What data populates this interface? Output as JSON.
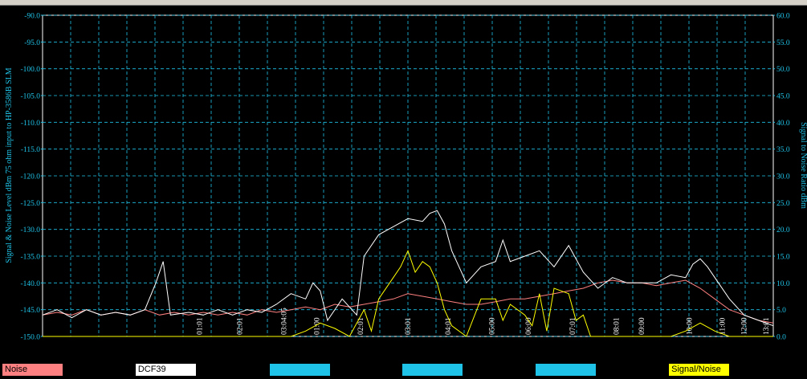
{
  "chart_data": {
    "type": "line",
    "left_axis": {
      "label": "Signal & Noise Level  dBm 75 ohm input to HP-3586B SLM",
      "min": -150,
      "max": -90,
      "step": 5,
      "ticks": [
        "-90.0",
        "-95.0",
        "-100.0",
        "-105.0",
        "-110.0",
        "-115.0",
        "-120.0",
        "-125.0",
        "-130.0",
        "-135.0",
        "-140.0",
        "-145.0",
        "-150.0"
      ]
    },
    "right_axis": {
      "label": "Signal to Noise Ratio  dBm",
      "min": 0,
      "max": 60,
      "step": 5,
      "ticks": [
        "60.0",
        "55.0",
        "50.0",
        "45.0",
        "40.0",
        "35.0",
        "30.0",
        "25.0",
        "20.0",
        "15.0",
        "10.0",
        "5.0",
        "0.0"
      ]
    },
    "x_tick_labels": [
      {
        "x": 0.215,
        "text": "01:01"
      },
      {
        "x": 0.27,
        "text": "02:01"
      },
      {
        "x": 0.33,
        "text": "03:04:05"
      },
      {
        "x": 0.375,
        "text": "01:00"
      },
      {
        "x": 0.435,
        "text": "02:01"
      },
      {
        "x": 0.5,
        "text": "03:01"
      },
      {
        "x": 0.555,
        "text": "04:01"
      },
      {
        "x": 0.615,
        "text": "05:00"
      },
      {
        "x": 0.665,
        "text": "06:00"
      },
      {
        "x": 0.725,
        "text": "07:01"
      },
      {
        "x": 0.785,
        "text": "08:01"
      },
      {
        "x": 0.82,
        "text": "09:00"
      },
      {
        "x": 0.885,
        "text": "10:00"
      },
      {
        "x": 0.93,
        "text": "11:00"
      },
      {
        "x": 0.96,
        "text": "12:00"
      },
      {
        "x": 0.99,
        "text": "13:01"
      }
    ],
    "grid": true,
    "series": [
      {
        "name": "Noise",
        "axis": "left",
        "color": "#ff8080",
        "points": [
          [
            0,
            -146
          ],
          [
            0.02,
            -145.5
          ],
          [
            0.04,
            -146
          ],
          [
            0.06,
            -145
          ],
          [
            0.08,
            -146
          ],
          [
            0.1,
            -145.5
          ],
          [
            0.12,
            -146
          ],
          [
            0.14,
            -145
          ],
          [
            0.16,
            -146
          ],
          [
            0.18,
            -145.5
          ],
          [
            0.2,
            -146
          ],
          [
            0.22,
            -145.5
          ],
          [
            0.24,
            -146
          ],
          [
            0.26,
            -145.5
          ],
          [
            0.28,
            -146
          ],
          [
            0.3,
            -145
          ],
          [
            0.32,
            -145.5
          ],
          [
            0.34,
            -145
          ],
          [
            0.36,
            -144.5
          ],
          [
            0.38,
            -145
          ],
          [
            0.4,
            -144
          ],
          [
            0.42,
            -144.5
          ],
          [
            0.44,
            -144
          ],
          [
            0.46,
            -143.5
          ],
          [
            0.48,
            -143
          ],
          [
            0.5,
            -142
          ],
          [
            0.52,
            -142.5
          ],
          [
            0.54,
            -143
          ],
          [
            0.56,
            -143.5
          ],
          [
            0.58,
            -144
          ],
          [
            0.6,
            -144
          ],
          [
            0.62,
            -143.5
          ],
          [
            0.64,
            -143
          ],
          [
            0.66,
            -143
          ],
          [
            0.68,
            -142.5
          ],
          [
            0.7,
            -142
          ],
          [
            0.72,
            -141.5
          ],
          [
            0.74,
            -141
          ],
          [
            0.76,
            -140
          ],
          [
            0.78,
            -139.5
          ],
          [
            0.8,
            -140
          ],
          [
            0.82,
            -140
          ],
          [
            0.84,
            -140.5
          ],
          [
            0.86,
            -140
          ],
          [
            0.88,
            -139.5
          ],
          [
            0.9,
            -141
          ],
          [
            0.92,
            -143
          ],
          [
            0.94,
            -145
          ],
          [
            0.96,
            -146
          ],
          [
            0.98,
            -147
          ],
          [
            1,
            -147.5
          ]
        ]
      },
      {
        "name": "DCF39",
        "axis": "left",
        "color": "#ffffff",
        "points": [
          [
            0,
            -146
          ],
          [
            0.02,
            -145
          ],
          [
            0.04,
            -146.5
          ],
          [
            0.06,
            -145
          ],
          [
            0.08,
            -146
          ],
          [
            0.1,
            -145.5
          ],
          [
            0.12,
            -146
          ],
          [
            0.14,
            -145
          ],
          [
            0.155,
            -140
          ],
          [
            0.165,
            -136
          ],
          [
            0.175,
            -146
          ],
          [
            0.2,
            -145.5
          ],
          [
            0.22,
            -146
          ],
          [
            0.24,
            -145
          ],
          [
            0.26,
            -146
          ],
          [
            0.28,
            -145
          ],
          [
            0.3,
            -145.5
          ],
          [
            0.32,
            -144
          ],
          [
            0.34,
            -142
          ],
          [
            0.36,
            -143
          ],
          [
            0.37,
            -140
          ],
          [
            0.38,
            -141.5
          ],
          [
            0.39,
            -147
          ],
          [
            0.41,
            -143
          ],
          [
            0.43,
            -146
          ],
          [
            0.44,
            -135
          ],
          [
            0.46,
            -131
          ],
          [
            0.48,
            -129.5
          ],
          [
            0.5,
            -128
          ],
          [
            0.52,
            -128.5
          ],
          [
            0.53,
            -127
          ],
          [
            0.54,
            -126.5
          ],
          [
            0.55,
            -129
          ],
          [
            0.56,
            -134
          ],
          [
            0.58,
            -140
          ],
          [
            0.6,
            -137
          ],
          [
            0.62,
            -136
          ],
          [
            0.63,
            -132
          ],
          [
            0.64,
            -136
          ],
          [
            0.66,
            -135
          ],
          [
            0.68,
            -134
          ],
          [
            0.7,
            -137
          ],
          [
            0.72,
            -133
          ],
          [
            0.74,
            -138
          ],
          [
            0.76,
            -141
          ],
          [
            0.78,
            -139
          ],
          [
            0.8,
            -140
          ],
          [
            0.82,
            -140
          ],
          [
            0.84,
            -140
          ],
          [
            0.86,
            -138.5
          ],
          [
            0.88,
            -139
          ],
          [
            0.89,
            -136.5
          ],
          [
            0.9,
            -135.5
          ],
          [
            0.91,
            -137
          ],
          [
            0.92,
            -139
          ],
          [
            0.94,
            -143
          ],
          [
            0.96,
            -146
          ],
          [
            0.98,
            -147
          ],
          [
            1,
            -148
          ]
        ]
      },
      {
        "name": "Signal/Noise",
        "axis": "right",
        "color": "#ffff00",
        "points": [
          [
            0,
            0
          ],
          [
            0.2,
            0
          ],
          [
            0.3,
            0
          ],
          [
            0.34,
            0
          ],
          [
            0.36,
            1
          ],
          [
            0.38,
            2.5
          ],
          [
            0.4,
            1.5
          ],
          [
            0.42,
            0
          ],
          [
            0.44,
            5
          ],
          [
            0.45,
            1
          ],
          [
            0.46,
            7
          ],
          [
            0.48,
            11
          ],
          [
            0.49,
            13
          ],
          [
            0.5,
            16
          ],
          [
            0.51,
            12
          ],
          [
            0.52,
            14
          ],
          [
            0.53,
            13
          ],
          [
            0.54,
            10
          ],
          [
            0.55,
            5
          ],
          [
            0.56,
            2
          ],
          [
            0.58,
            0
          ],
          [
            0.6,
            7
          ],
          [
            0.62,
            7
          ],
          [
            0.63,
            3
          ],
          [
            0.64,
            6
          ],
          [
            0.66,
            4
          ],
          [
            0.67,
            2
          ],
          [
            0.68,
            8
          ],
          [
            0.69,
            1
          ],
          [
            0.7,
            9
          ],
          [
            0.72,
            8
          ],
          [
            0.73,
            3
          ],
          [
            0.74,
            4
          ],
          [
            0.75,
            0
          ],
          [
            0.78,
            0
          ],
          [
            0.8,
            0
          ],
          [
            0.86,
            0
          ],
          [
            0.88,
            1
          ],
          [
            0.9,
            2.5
          ],
          [
            0.92,
            1
          ],
          [
            0.94,
            0
          ],
          [
            0.96,
            0
          ],
          [
            1,
            0
          ]
        ]
      }
    ],
    "legend": [
      {
        "label": "Noise",
        "color": "#ff8080",
        "x": 0.003
      },
      {
        "label": "DCF39",
        "color": "#ffffff",
        "x": 0.168
      },
      {
        "label": "",
        "color": "#1fc3e8",
        "x": 0.334
      },
      {
        "label": "",
        "color": "#1fc3e8",
        "x": 0.499
      },
      {
        "label": "",
        "color": "#1fc3e8",
        "x": 0.664
      },
      {
        "label": "Signal/Noise",
        "color": "#ffff00",
        "x": 0.829
      }
    ],
    "colors": {
      "background": "#000000",
      "grid": "#1fc3e8",
      "axis_text": "#1fc3e8",
      "frame": "#ffffff"
    }
  }
}
